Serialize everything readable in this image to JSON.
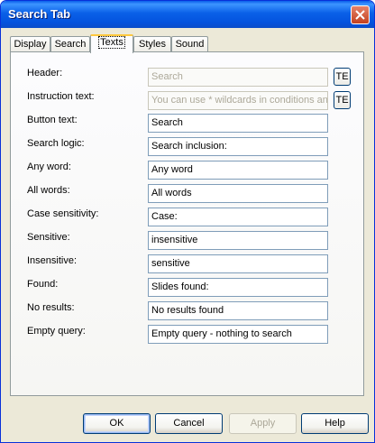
{
  "window": {
    "title": "Search Tab"
  },
  "tabs": [
    {
      "label": "Display"
    },
    {
      "label": "Search"
    },
    {
      "label": "Texts"
    },
    {
      "label": "Styles"
    },
    {
      "label": "Sound"
    }
  ],
  "active_tab": "Texts",
  "fields": [
    {
      "label": "Header:",
      "value": "Search",
      "disabled": true,
      "te_label": "TE"
    },
    {
      "label": "Instruction text:",
      "value": "You can use * wildcards in conditions an",
      "disabled": true,
      "te_label": "TE"
    },
    {
      "label": "Button text:",
      "value": "Search"
    },
    {
      "label": "Search logic:",
      "value": "Search inclusion:"
    },
    {
      "label": "Any word:",
      "value": "Any word"
    },
    {
      "label": "All words:",
      "value": "All words"
    },
    {
      "label": "Case sensitivity:",
      "value": "Case:"
    },
    {
      "label": "Sensitive:",
      "value": "insensitive"
    },
    {
      "label": "Insensitive:",
      "value": "sensitive"
    },
    {
      "label": "Found:",
      "value": "Slides found:"
    },
    {
      "label": "No results:",
      "value": "No results found"
    },
    {
      "label": "Empty query:",
      "value": "Empty query - nothing to search"
    }
  ],
  "buttons": {
    "ok": "OK",
    "cancel": "Cancel",
    "apply": "Apply",
    "help": "Help"
  },
  "colors": {
    "titlebar": "#0A5FEA",
    "dialog_bg": "#ECE9D8",
    "field_border": "#7F9DB9",
    "active_tab_accent": "#FFC83C"
  }
}
